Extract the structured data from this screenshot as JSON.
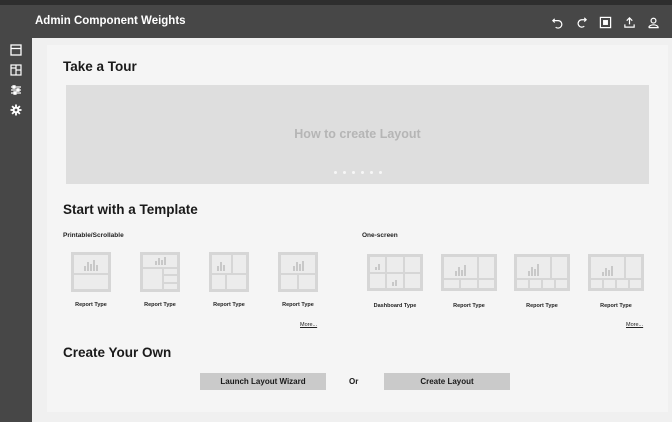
{
  "app": {
    "title": "Admin Component Weights"
  },
  "toolbar": {
    "icons": [
      "undo-icon",
      "redo-icon",
      "preview-icon",
      "export-icon",
      "user-icon"
    ]
  },
  "sidebar": {
    "icons": [
      "layout-icon",
      "components-icon",
      "filters-icon",
      "settings-icon"
    ]
  },
  "tour": {
    "title": "Take a Tour",
    "banner_text": "How to create Layout",
    "dots_count": 6
  },
  "templates": {
    "title": "Start with a Template",
    "printable": {
      "label": "Printable/Scrollable",
      "items": [
        "Report Type",
        "Report Type",
        "Report Type",
        "Report Type"
      ],
      "more": "More..."
    },
    "onescreen": {
      "label": "One-screen",
      "items": [
        "Dashboard Type",
        "Report Type",
        "Report Type",
        "Report Type"
      ],
      "more": "More..."
    }
  },
  "create": {
    "title": "Create Your Own",
    "wizard_label": "Launch Layout Wizard",
    "or_label": "Or",
    "create_label": "Create Layout"
  },
  "colors": {
    "chrome": "#474747",
    "banner": "#dedede",
    "button": "#cacaca"
  }
}
